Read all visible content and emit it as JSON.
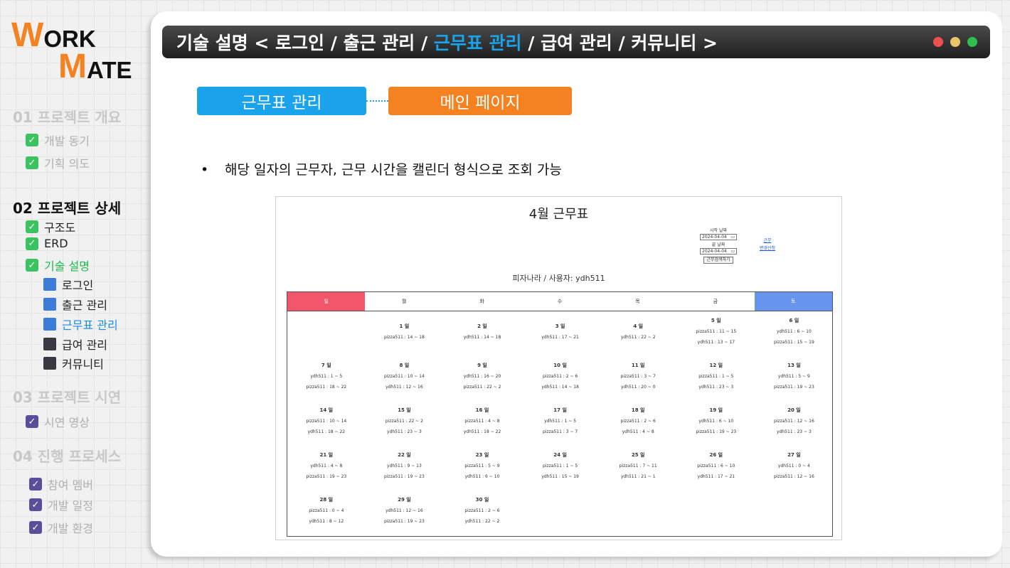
{
  "logo": {
    "w": "W",
    "ork": "ORK",
    "m": "M",
    "ate": "ATE"
  },
  "sidebar": {
    "s1": {
      "title": "01 프로젝트 개요",
      "items": [
        "개발 동기",
        "기획 의도"
      ]
    },
    "s2": {
      "title": "02 프로젝트 상세",
      "items": [
        "구조도",
        "ERD",
        "기술 설명"
      ],
      "sub": [
        "로그인",
        "출근 관리",
        "근무표 관리",
        "급여 관리",
        "커뮤니티"
      ]
    },
    "s3": {
      "title": "03 프로젝트 시연",
      "items": [
        "시연 영상"
      ]
    },
    "s4": {
      "title": "04 진행 프로세스",
      "items": [
        "참여 멤버",
        "개발 일정",
        "개발 환경"
      ]
    }
  },
  "header": {
    "prefix": "기술 설명 < 로그인 / 출근 관리 / ",
    "current": "근무표 관리",
    "suffix": " / 급여 관리 / 커뮤니티 >",
    "dot_colors": [
      "#ee5050",
      "#e9c46a",
      "#2ebd4f"
    ]
  },
  "pills": {
    "left": "근무표 관리",
    "right": "메인 페이지"
  },
  "bullet": "해당 일자의 근무자, 근무 시간을 캘린더 형식으로 조회 가능",
  "calendar": {
    "title": "4월 근무표",
    "start_label": "시작 날짜",
    "start_value": "2024-04-04",
    "end_label": "끝 날짜",
    "end_value": "2024-04-04",
    "search_btn": "근무검색하기",
    "link1": "근무",
    "link2": "변경신청",
    "store_line": "피자나라 / 사용자: ydh511",
    "weekdays": [
      "일",
      "월",
      "화",
      "수",
      "목",
      "금",
      "토"
    ],
    "days": [
      {
        "d": "1 일",
        "l": [
          "pizza511 : 14 ~ 18"
        ]
      },
      {
        "d": "2 일",
        "l": [
          "ydh511 : 14 ~ 18"
        ]
      },
      {
        "d": "3 일",
        "l": [
          "ydh511 : 17 ~ 21"
        ]
      },
      {
        "d": "4 일",
        "l": [
          "ydh511 : 22 ~ 2"
        ]
      },
      {
        "d": "5 일",
        "l": [
          "pizza511 : 11 ~ 15",
          "ydh511 : 13 ~ 17"
        ]
      },
      {
        "d": "6 일",
        "l": [
          "ydh511 : 6 ~ 10",
          "pizza511 : 15 ~ 19"
        ]
      },
      {
        "d": "7 일",
        "l": [
          "ydh511 : 1 ~ 5",
          "pizza511 : 18 ~ 22"
        ]
      },
      {
        "d": "8 일",
        "l": [
          "pizza511 : 10 ~ 14",
          "ydh511 : 12 ~ 16"
        ]
      },
      {
        "d": "9 일",
        "l": [
          "ydh511 : 16 ~ 20",
          "pizza511 : 22 ~ 2"
        ]
      },
      {
        "d": "10 일",
        "l": [
          "pizza511 : 2 ~ 6",
          "ydh511 : 14 ~ 18"
        ]
      },
      {
        "d": "11 일",
        "l": [
          "pizza511 : 3 ~ 7",
          "ydh511 : 20 ~ 0"
        ]
      },
      {
        "d": "12 일",
        "l": [
          "pizza511 : 1 ~ 5",
          "ydh511 : 23 ~ 3"
        ]
      },
      {
        "d": "13 일",
        "l": [
          "ydh511 : 5 ~ 9",
          "pizza511 : 19 ~ 23"
        ]
      },
      {
        "d": "14 일",
        "l": [
          "pizza511 : 10 ~ 14",
          "ydh511 : 18 ~ 22"
        ]
      },
      {
        "d": "15 일",
        "l": [
          "pizza511 : 22 ~ 2",
          "ydh511 : 23 ~ 3"
        ]
      },
      {
        "d": "16 일",
        "l": [
          "pizza511 : 4 ~ 8",
          "ydh511 : 18 ~ 22"
        ]
      },
      {
        "d": "17 일",
        "l": [
          "ydh511 : 1 ~ 5",
          "pizza511 : 3 ~ 7"
        ]
      },
      {
        "d": "18 일",
        "l": [
          "pizza511 : 2 ~ 6",
          "ydh511 : 4 ~ 8"
        ]
      },
      {
        "d": "19 일",
        "l": [
          "ydh511 : 6 ~ 10",
          "pizza511 : 19 ~ 23"
        ]
      },
      {
        "d": "20 일",
        "l": [
          "pizza511 : 12 ~ 16",
          "ydh511 : 23 ~ 3"
        ]
      },
      {
        "d": "21 일",
        "l": [
          "ydh511 : 4 ~ 8",
          "pizza511 : 19 ~ 23"
        ]
      },
      {
        "d": "22 일",
        "l": [
          "ydh511 : 9 ~ 13",
          "pizza511 : 19 ~ 23"
        ]
      },
      {
        "d": "23 일",
        "l": [
          "pizza511 : 5 ~ 9",
          "ydh511 : 6 ~ 10"
        ]
      },
      {
        "d": "24 일",
        "l": [
          "pizza511 : 1 ~ 5",
          "ydh511 : 15 ~ 19"
        ]
      },
      {
        "d": "25 일",
        "l": [
          "pizza511 : 7 ~ 11",
          "ydh511 : 21 ~ 1"
        ]
      },
      {
        "d": "26 일",
        "l": [
          "pizza511 : 6 ~ 10",
          "ydh511 : 17 ~ 21"
        ]
      },
      {
        "d": "27 일",
        "l": [
          "ydh511 : 0 ~ 4",
          "pizza511 : 12 ~ 16"
        ]
      },
      {
        "d": "28 일",
        "l": [
          "pizza511 : 0 ~ 4",
          "ydh511 : 8 ~ 12"
        ]
      },
      {
        "d": "29 일",
        "l": [
          "ydh511 : 12 ~ 16",
          "pizza511 : 19 ~ 23"
        ]
      },
      {
        "d": "30 일",
        "l": [
          "pizza511 : 2 ~ 6",
          "ydh511 : 22 ~ 2"
        ]
      }
    ]
  }
}
